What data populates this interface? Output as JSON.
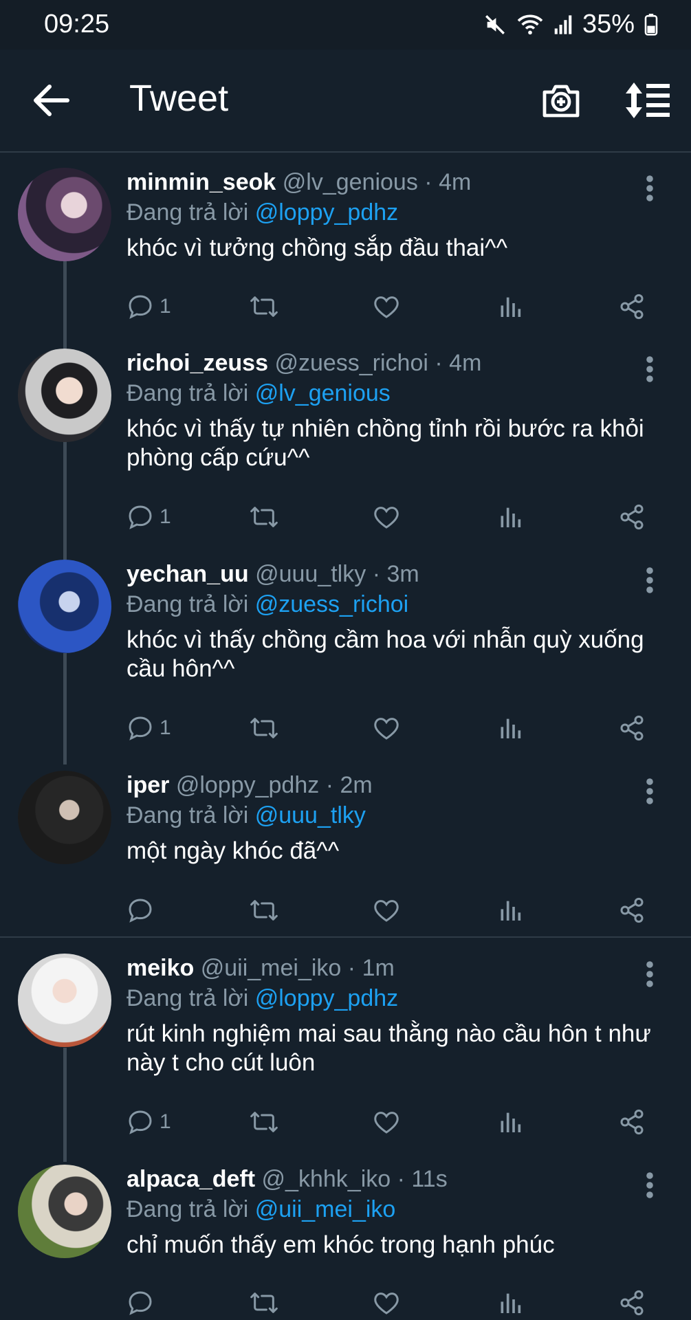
{
  "status_bar": {
    "time": "09:25",
    "battery": "35%"
  },
  "header": {
    "title": "Tweet"
  },
  "reply_prefix": "Đang trả lời",
  "tweets": [
    {
      "name": "minmin_seok",
      "handle": "@lv_genious",
      "time": "4m",
      "reply_to": "@loppy_pdhz",
      "text": "khóc vì tưởng chồng sắp đầu thai^^",
      "reply_count": "1"
    },
    {
      "name": "richoi_zeuss",
      "handle": "@zuess_richoi",
      "time": "4m",
      "reply_to": "@lv_genious",
      "text": "khóc vì thấy tự nhiên chồng tỉnh rồi bước ra khỏi phòng cấp cứu^^",
      "reply_count": "1"
    },
    {
      "name": "yechan_uu",
      "handle": "@uuu_tlky",
      "time": "3m",
      "reply_to": "@zuess_richoi",
      "text": "khóc vì thấy chồng cầm hoa với nhẫn quỳ xuống cầu hôn^^",
      "reply_count": "1"
    },
    {
      "name": "iper",
      "handle": "@loppy_pdhz",
      "time": "2m",
      "reply_to": "@uuu_tlky",
      "text": "một ngày khóc đã^^",
      "reply_count": ""
    },
    {
      "name": "meiko",
      "handle": "@uii_mei_iko",
      "time": "1m",
      "reply_to": "@loppy_pdhz",
      "text": "rút kinh nghiệm mai sau thằng nào cầu hôn t như này t cho cút luôn",
      "reply_count": "1"
    },
    {
      "name": "alpaca_deft",
      "handle": "@_khhk_iko",
      "time": "11s",
      "reply_to": "@uii_mei_iko",
      "text": "chỉ muốn thấy em khóc trong hạnh phúc",
      "reply_count": ""
    }
  ],
  "icons": {
    "back": "arrow-left-icon",
    "camera": "camera-add-icon",
    "sort": "sort-icon",
    "reply": "reply-icon",
    "retweet": "retweet-icon",
    "like": "heart-icon",
    "analytics": "analytics-icon",
    "share": "share-icon",
    "more": "more-vertical-icon"
  },
  "colors": {
    "background": "#15202b",
    "accent": "#1da1f2",
    "muted": "#8899a6"
  }
}
